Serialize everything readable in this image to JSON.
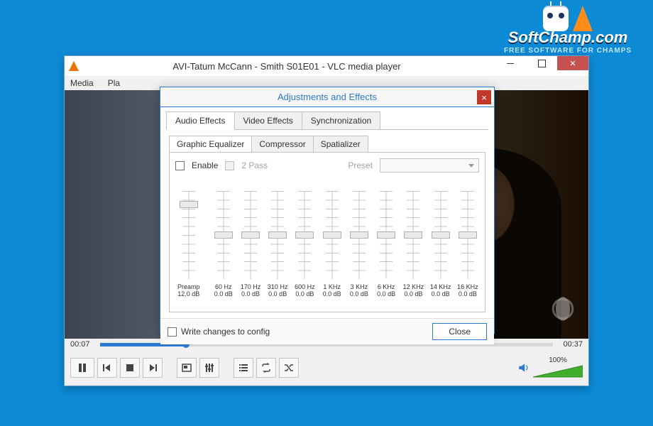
{
  "watermark": {
    "main": "SoftChamp.com",
    "sub": "FREE SOFTWARE FOR CHAMPS"
  },
  "vlc": {
    "title": "AVI-Tatum McCann - Smith S01E01 - VLC media player",
    "menu": [
      "Media",
      "Pla"
    ],
    "time_current": "00:07",
    "time_total": "00:37",
    "seek_pct": 19,
    "volume_pct": "100%",
    "buttons": {
      "pause": "pause",
      "prev": "previous",
      "stop": "stop",
      "next": "next",
      "fullscreen": "fullscreen",
      "ext": "extended-settings",
      "playlist": "playlist",
      "loop": "loop",
      "shuffle": "shuffle"
    }
  },
  "dialog": {
    "title": "Adjustments and Effects",
    "tabs": [
      "Audio Effects",
      "Video Effects",
      "Synchronization"
    ],
    "subtabs": [
      "Graphic Equalizer",
      "Compressor",
      "Spatializer"
    ],
    "enable_label": "Enable",
    "twopass_label": "2 Pass",
    "preset_label": "Preset",
    "preamp_label": "Preamp",
    "preamp_value": "12.0 dB",
    "bands": [
      {
        "freq": "60 Hz",
        "db": "0.0 dB"
      },
      {
        "freq": "170 Hz",
        "db": "0.0 dB"
      },
      {
        "freq": "310 Hz",
        "db": "0.0 dB"
      },
      {
        "freq": "600 Hz",
        "db": "0.0 dB"
      },
      {
        "freq": "1 KHz",
        "db": "0.0 dB"
      },
      {
        "freq": "3 KHz",
        "db": "0.0 dB"
      },
      {
        "freq": "6 KHz",
        "db": "0.0 dB"
      },
      {
        "freq": "12 KHz",
        "db": "0.0 dB"
      },
      {
        "freq": "14 KHz",
        "db": "0.0 dB"
      },
      {
        "freq": "16 KHz",
        "db": "0.0 dB"
      }
    ],
    "write_label": "Write changes to config",
    "close_label": "Close"
  }
}
